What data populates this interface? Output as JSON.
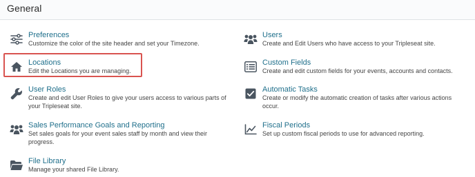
{
  "header": {
    "title": "General"
  },
  "highlight": {
    "color": "#d9534f",
    "target": "Locations"
  },
  "colors": {
    "link": "#1f6f8b",
    "text": "#444444",
    "icon": "#4a5560"
  },
  "left_items": [
    {
      "title": "Preferences",
      "desc": "Customize the color of the site header and set your Timezone.",
      "icon": "sliders-icon"
    },
    {
      "title": "Locations",
      "desc": "Edit the Locations you are managing.",
      "icon": "home-icon"
    },
    {
      "title": "User Roles",
      "desc": "Create and edit User Roles to give your users access to various parts of your Tripleseat site.",
      "icon": "wrench-icon"
    },
    {
      "title": "Sales Performance Goals and Reporting",
      "desc": "Set sales goals for your event sales staff by month and view their progress.",
      "icon": "users-icon"
    },
    {
      "title": "File Library",
      "desc": "Manage your shared File Library.",
      "icon": "folder-icon"
    }
  ],
  "right_items": [
    {
      "title": "Users",
      "desc": "Create and Edit Users who have access to your Tripleseat site.",
      "icon": "users-icon"
    },
    {
      "title": "Custom Fields",
      "desc": "Create and edit custom fields for your events, accounts and contacts.",
      "icon": "list-icon"
    },
    {
      "title": "Automatic Tasks",
      "desc": "Create or modify the automatic creation of tasks after various actions occur.",
      "icon": "checkbox-icon"
    },
    {
      "title": "Fiscal Periods",
      "desc": "Set up custom fiscal periods to use for advanced reporting.",
      "icon": "line-chart-icon"
    }
  ]
}
